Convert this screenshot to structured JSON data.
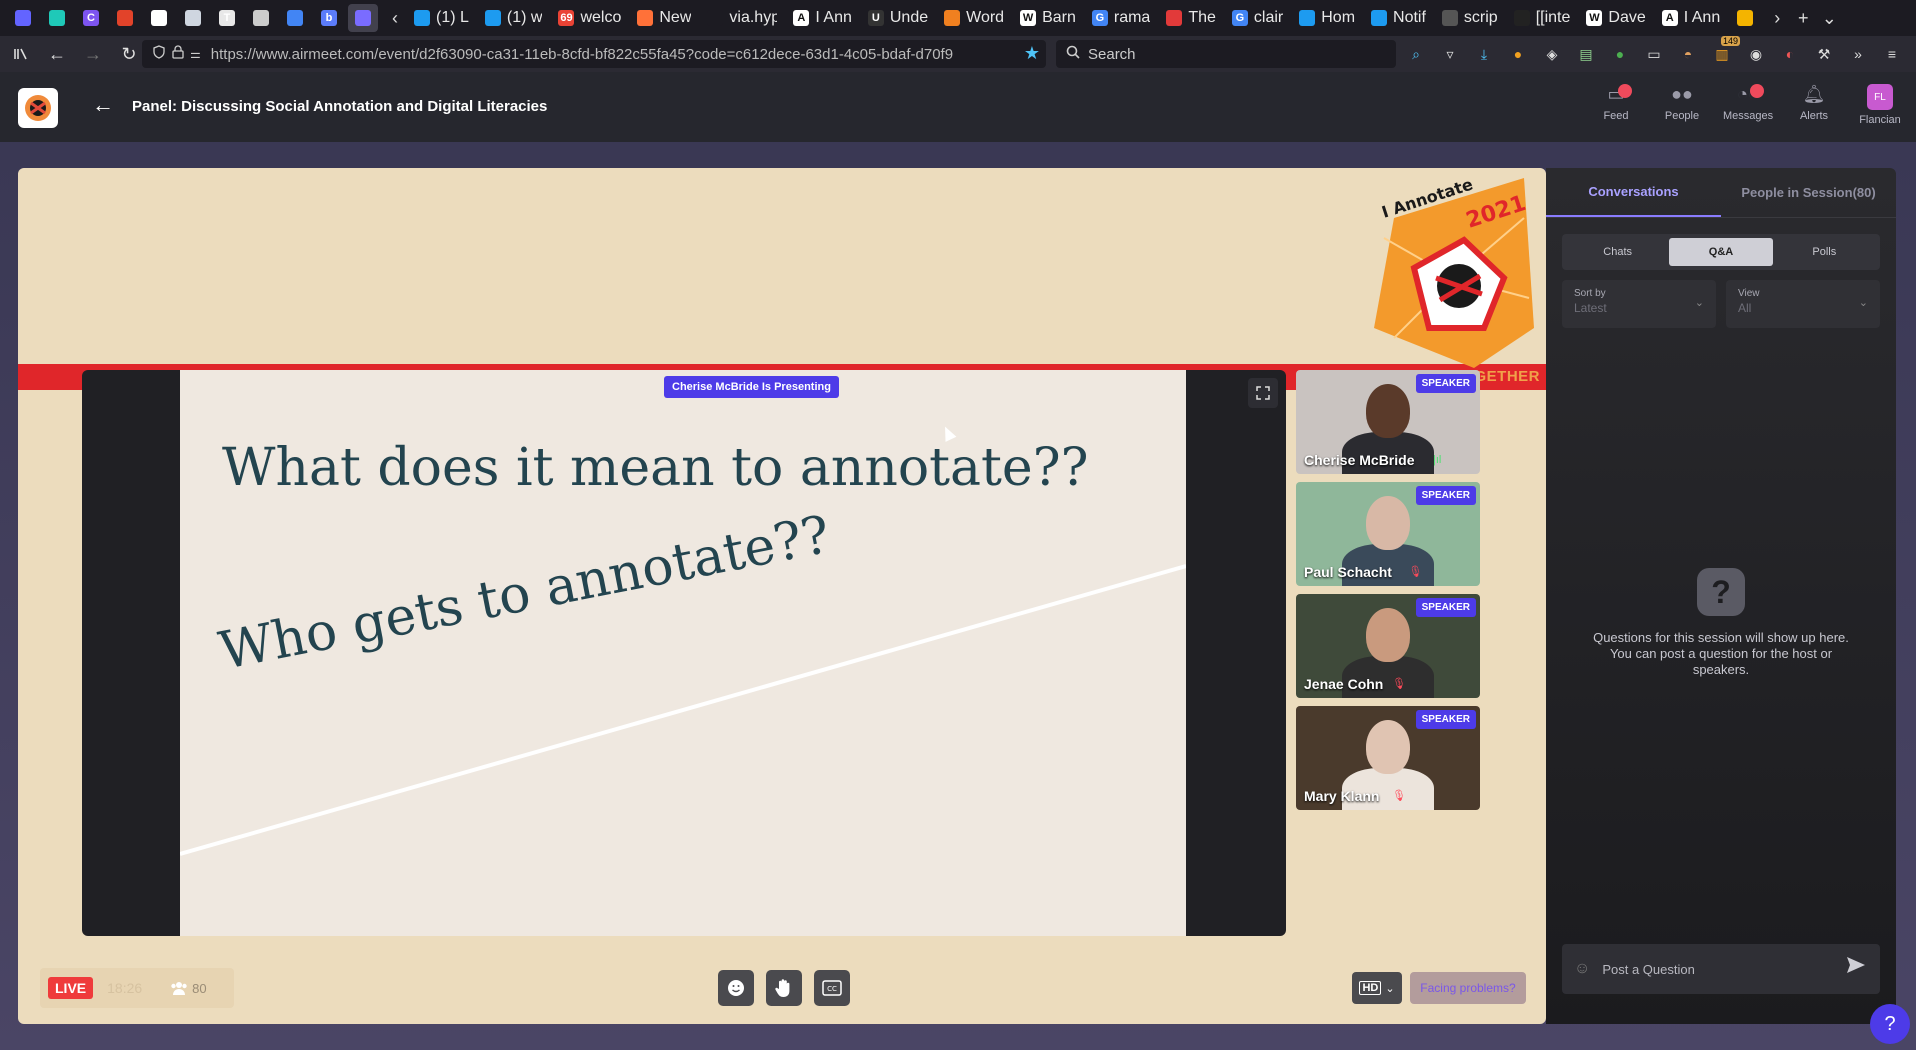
{
  "browser": {
    "tabs": [
      {
        "icon": "mastodon-icon",
        "label": "",
        "color": "#6364ff",
        "pinned": true
      },
      {
        "icon": "puzzle-icon",
        "label": "",
        "color": "#1fc9b8",
        "pinned": true
      },
      {
        "icon": "c-app-icon",
        "label": "",
        "color": "#7d54f0",
        "glyph": "C",
        "pinned": true
      },
      {
        "icon": "gitlab-icon",
        "label": "",
        "color": "#e2432a",
        "pinned": true
      },
      {
        "icon": "medium-icon",
        "label": "",
        "color": "#ffffff",
        "pinned": true
      },
      {
        "icon": "book-icon",
        "label": "",
        "color": "#cfd6e0",
        "pinned": true
      },
      {
        "icon": "t-app-icon",
        "label": "",
        "color": "#e8e8e8",
        "glyph": "T",
        "pinned": true
      },
      {
        "icon": "globe-icon",
        "label": "",
        "color": "#cccccc",
        "pinned": true
      },
      {
        "icon": "calendar-icon",
        "label": "",
        "color": "#4285f4",
        "pinned": true
      },
      {
        "icon": "b-app-icon",
        "label": "",
        "color": "#5b7cfa",
        "glyph": "b",
        "pinned": true
      },
      {
        "icon": "airmeet-icon",
        "label": "",
        "color": "#7a6cff",
        "pinned": true,
        "active": true
      },
      {
        "icon": "twitter-icon",
        "label": "(1) L",
        "color": "#1d9bf0"
      },
      {
        "icon": "twitter-icon",
        "label": "(1) w",
        "color": "#1d9bf0"
      },
      {
        "icon": "gmail-icon",
        "label": "welco",
        "color": "#ea4335",
        "glyph": "69"
      },
      {
        "icon": "firefox-icon",
        "label": "New",
        "color": "#ff7139"
      },
      {
        "icon": "hypothesis-icon",
        "label": "via.hyp",
        "color": "#1c1b22"
      },
      {
        "icon": "annotate-icon",
        "label": "I Ann",
        "color": "#ffffff",
        "glyph": "A"
      },
      {
        "icon": "u-app-icon",
        "label": "Unde",
        "color": "#333333",
        "glyph": "U"
      },
      {
        "icon": "heart-icon",
        "label": "Word",
        "color": "#f08020"
      },
      {
        "icon": "wikipedia-icon",
        "label": "Barn",
        "color": "#ffffff",
        "glyph": "W"
      },
      {
        "icon": "google-icon",
        "label": "rama",
        "color": "#4285f4",
        "glyph": "G"
      },
      {
        "icon": "chat-icon",
        "label": "The",
        "color": "#e23a3a"
      },
      {
        "icon": "google-icon",
        "label": "clair",
        "color": "#4285f4",
        "glyph": "G"
      },
      {
        "icon": "twitter-icon",
        "label": "Hom",
        "color": "#1d9bf0"
      },
      {
        "icon": "twitter-icon",
        "label": "Notif",
        "color": "#1d9bf0"
      },
      {
        "icon": "loading-icon",
        "label": "scrip",
        "color": "#555555"
      },
      {
        "icon": "obsidian-icon",
        "label": "[[inte",
        "color": "#222222"
      },
      {
        "icon": "wikipedia-icon",
        "label": "Dave",
        "color": "#ffffff",
        "glyph": "W"
      },
      {
        "icon": "annotate-icon",
        "label": "I Ann",
        "color": "#ffffff",
        "glyph": "A"
      },
      {
        "icon": "slides-icon",
        "label": "",
        "color": "#f4b400",
        "pinned": true
      }
    ],
    "url": "https://www.airmeet.com/event/d2f63090-ca31-11eb-8cfd-bf822c55fa45?code=c612dece-63d1-4c05-bdaf-d70f9",
    "search_placeholder": "Search",
    "extension_badge": "149"
  },
  "header": {
    "title": "Panel: Discussing Social Annotation and Digital Literacies",
    "nav": [
      {
        "label": "Feed",
        "icon": "feed-icon",
        "dot": true
      },
      {
        "label": "People",
        "icon": "people-icon",
        "dot": false
      },
      {
        "label": "Messages",
        "icon": "messages-icon",
        "dot": true
      },
      {
        "label": "Alerts",
        "icon": "bell-icon",
        "dot": false
      },
      {
        "label": "Flancian",
        "icon": "avatar",
        "initials": "FL",
        "dot": false
      }
    ]
  },
  "stage": {
    "badge_text_1": "I Annotate",
    "badge_text_2": "2021",
    "banner_text": "GETHER",
    "presenting": "Cherise McBride Is Presenting",
    "slide": {
      "line1": "What does it mean to annotate??",
      "line2": "Who gets to annotate??"
    },
    "speakers": [
      {
        "name": "Cherise McBride",
        "tag": "SPEAKER",
        "muted": false,
        "bg": "#c9c3c0",
        "skin": "#5a3a2a",
        "shirt": "#2b2b30"
      },
      {
        "name": "Paul Schacht",
        "tag": "SPEAKER",
        "muted": true,
        "bg": "#8fb79a",
        "skin": "#d8b8a6",
        "shirt": "#3a4a5a"
      },
      {
        "name": "Jenae Cohn",
        "tag": "SPEAKER",
        "muted": true,
        "bg": "#3f4a3a",
        "skin": "#c99a7e",
        "shirt": "#2e2e2e"
      },
      {
        "name": "Mary Klann",
        "tag": "SPEAKER",
        "muted": true,
        "bg": "#4a3a2c",
        "skin": "#e0c4b2",
        "shirt": "#ece4dc"
      }
    ],
    "live_label": "LIVE",
    "timer": "18:26",
    "attendee_count": "80",
    "hd_label": "HD",
    "facing_problems": "Facing problems?"
  },
  "panel": {
    "tabs": [
      "Conversations",
      "People in Session(80)"
    ],
    "active_tab": 0,
    "subtabs": [
      "Chats",
      "Q&A",
      "Polls"
    ],
    "active_subtab": 1,
    "sort_by_label": "Sort by",
    "sort_by_value": "Latest",
    "view_label": "View",
    "view_value": "All",
    "empty_text": "Questions for this session will show up here. You can post a question for the host or speakers.",
    "post_placeholder": "Post a Question"
  },
  "colors": {
    "accent": "#4d3be8",
    "live_red": "#ef3b3b",
    "stage_bg": "#ecdcbd",
    "banner_red": "#e0262a",
    "slide_text": "#23444f"
  }
}
